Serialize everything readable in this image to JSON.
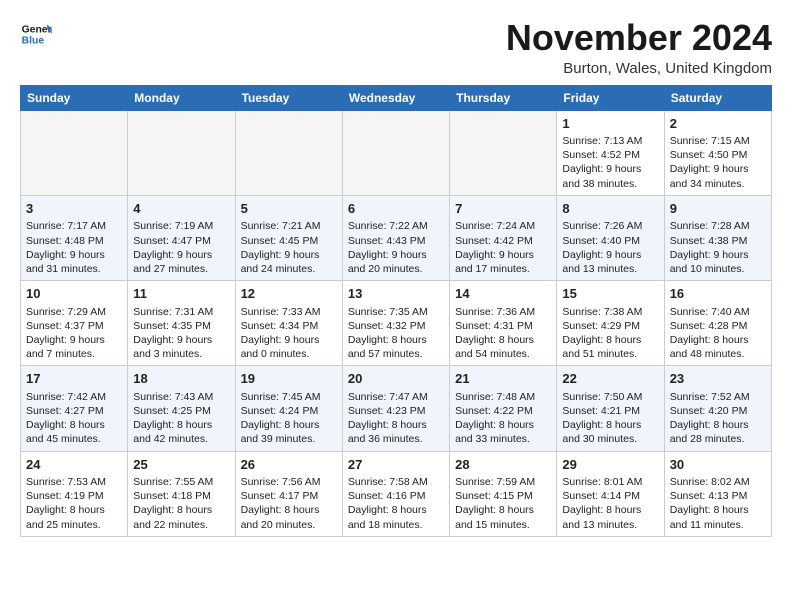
{
  "logo": {
    "line1": "General",
    "line2": "Blue"
  },
  "title": "November 2024",
  "location": "Burton, Wales, United Kingdom",
  "weekdays": [
    "Sunday",
    "Monday",
    "Tuesday",
    "Wednesday",
    "Thursday",
    "Friday",
    "Saturday"
  ],
  "weeks": [
    [
      {
        "day": "",
        "info": ""
      },
      {
        "day": "",
        "info": ""
      },
      {
        "day": "",
        "info": ""
      },
      {
        "day": "",
        "info": ""
      },
      {
        "day": "",
        "info": ""
      },
      {
        "day": "1",
        "info": "Sunrise: 7:13 AM\nSunset: 4:52 PM\nDaylight: 9 hours\nand 38 minutes."
      },
      {
        "day": "2",
        "info": "Sunrise: 7:15 AM\nSunset: 4:50 PM\nDaylight: 9 hours\nand 34 minutes."
      }
    ],
    [
      {
        "day": "3",
        "info": "Sunrise: 7:17 AM\nSunset: 4:48 PM\nDaylight: 9 hours\nand 31 minutes."
      },
      {
        "day": "4",
        "info": "Sunrise: 7:19 AM\nSunset: 4:47 PM\nDaylight: 9 hours\nand 27 minutes."
      },
      {
        "day": "5",
        "info": "Sunrise: 7:21 AM\nSunset: 4:45 PM\nDaylight: 9 hours\nand 24 minutes."
      },
      {
        "day": "6",
        "info": "Sunrise: 7:22 AM\nSunset: 4:43 PM\nDaylight: 9 hours\nand 20 minutes."
      },
      {
        "day": "7",
        "info": "Sunrise: 7:24 AM\nSunset: 4:42 PM\nDaylight: 9 hours\nand 17 minutes."
      },
      {
        "day": "8",
        "info": "Sunrise: 7:26 AM\nSunset: 4:40 PM\nDaylight: 9 hours\nand 13 minutes."
      },
      {
        "day": "9",
        "info": "Sunrise: 7:28 AM\nSunset: 4:38 PM\nDaylight: 9 hours\nand 10 minutes."
      }
    ],
    [
      {
        "day": "10",
        "info": "Sunrise: 7:29 AM\nSunset: 4:37 PM\nDaylight: 9 hours\nand 7 minutes."
      },
      {
        "day": "11",
        "info": "Sunrise: 7:31 AM\nSunset: 4:35 PM\nDaylight: 9 hours\nand 3 minutes."
      },
      {
        "day": "12",
        "info": "Sunrise: 7:33 AM\nSunset: 4:34 PM\nDaylight: 9 hours\nand 0 minutes."
      },
      {
        "day": "13",
        "info": "Sunrise: 7:35 AM\nSunset: 4:32 PM\nDaylight: 8 hours\nand 57 minutes."
      },
      {
        "day": "14",
        "info": "Sunrise: 7:36 AM\nSunset: 4:31 PM\nDaylight: 8 hours\nand 54 minutes."
      },
      {
        "day": "15",
        "info": "Sunrise: 7:38 AM\nSunset: 4:29 PM\nDaylight: 8 hours\nand 51 minutes."
      },
      {
        "day": "16",
        "info": "Sunrise: 7:40 AM\nSunset: 4:28 PM\nDaylight: 8 hours\nand 48 minutes."
      }
    ],
    [
      {
        "day": "17",
        "info": "Sunrise: 7:42 AM\nSunset: 4:27 PM\nDaylight: 8 hours\nand 45 minutes."
      },
      {
        "day": "18",
        "info": "Sunrise: 7:43 AM\nSunset: 4:25 PM\nDaylight: 8 hours\nand 42 minutes."
      },
      {
        "day": "19",
        "info": "Sunrise: 7:45 AM\nSunset: 4:24 PM\nDaylight: 8 hours\nand 39 minutes."
      },
      {
        "day": "20",
        "info": "Sunrise: 7:47 AM\nSunset: 4:23 PM\nDaylight: 8 hours\nand 36 minutes."
      },
      {
        "day": "21",
        "info": "Sunrise: 7:48 AM\nSunset: 4:22 PM\nDaylight: 8 hours\nand 33 minutes."
      },
      {
        "day": "22",
        "info": "Sunrise: 7:50 AM\nSunset: 4:21 PM\nDaylight: 8 hours\nand 30 minutes."
      },
      {
        "day": "23",
        "info": "Sunrise: 7:52 AM\nSunset: 4:20 PM\nDaylight: 8 hours\nand 28 minutes."
      }
    ],
    [
      {
        "day": "24",
        "info": "Sunrise: 7:53 AM\nSunset: 4:19 PM\nDaylight: 8 hours\nand 25 minutes."
      },
      {
        "day": "25",
        "info": "Sunrise: 7:55 AM\nSunset: 4:18 PM\nDaylight: 8 hours\nand 22 minutes."
      },
      {
        "day": "26",
        "info": "Sunrise: 7:56 AM\nSunset: 4:17 PM\nDaylight: 8 hours\nand 20 minutes."
      },
      {
        "day": "27",
        "info": "Sunrise: 7:58 AM\nSunset: 4:16 PM\nDaylight: 8 hours\nand 18 minutes."
      },
      {
        "day": "28",
        "info": "Sunrise: 7:59 AM\nSunset: 4:15 PM\nDaylight: 8 hours\nand 15 minutes."
      },
      {
        "day": "29",
        "info": "Sunrise: 8:01 AM\nSunset: 4:14 PM\nDaylight: 8 hours\nand 13 minutes."
      },
      {
        "day": "30",
        "info": "Sunrise: 8:02 AM\nSunset: 4:13 PM\nDaylight: 8 hours\nand 11 minutes."
      }
    ]
  ]
}
